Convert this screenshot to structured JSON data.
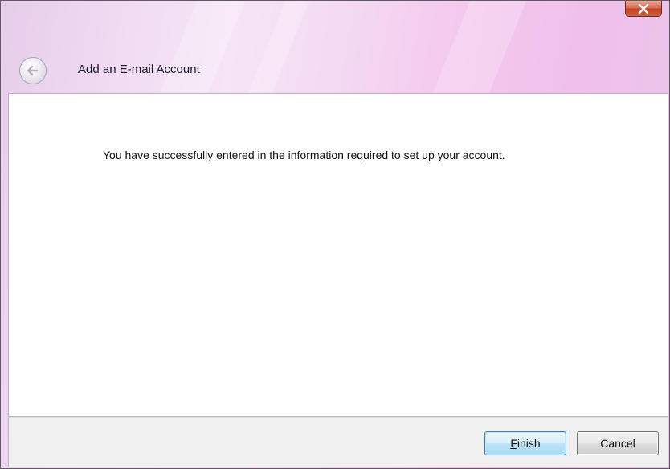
{
  "window": {
    "close_icon": "close-icon",
    "close_color": "#c23f22"
  },
  "header": {
    "back_icon": "back-arrow-icon",
    "title": "Add an E-mail Account"
  },
  "content": {
    "message": "You have successfully entered in the information required to set up your account."
  },
  "footer": {
    "finish_mnemonic": "F",
    "finish_rest": "inish",
    "cancel_label": "Cancel"
  }
}
